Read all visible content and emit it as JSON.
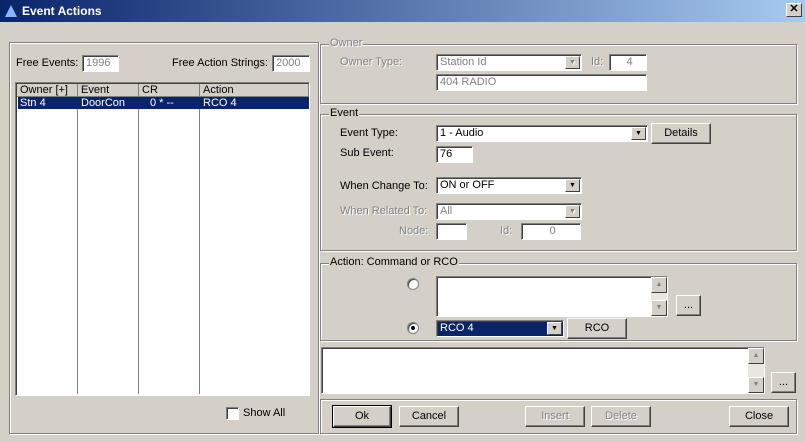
{
  "window": {
    "title": "Event Actions",
    "close": "✕"
  },
  "left": {
    "free_events_label": "Free Events:",
    "free_events": "1996",
    "free_strings_label": "Free Action Strings:",
    "free_strings": "2000",
    "columns": [
      "Owner [+]",
      "Event",
      "CR",
      "Action"
    ],
    "rows": [
      {
        "owner": "Stn 4",
        "event": "DoorCon",
        "cr": "0 * --",
        "action": "RCO 4"
      }
    ],
    "show_all": "Show All"
  },
  "owner": {
    "legend": "Owner",
    "type_label": "Owner Type:",
    "type_value": "Station Id",
    "id_label": "Id:",
    "id_value": "4",
    "name": "404 RADIO"
  },
  "event": {
    "legend": "Event",
    "type_label": "Event Type:",
    "type_value": "1 - Audio",
    "details": "Details",
    "sub_label": "Sub Event:",
    "sub_value": "76",
    "change_label": "When Change To:",
    "change_value": "ON or OFF",
    "related_label": "When Related To:",
    "related_value": "All",
    "node_label": "Node:",
    "node_value": "",
    "id_label": "Id:",
    "id_value": "0"
  },
  "action": {
    "legend": "Action: Command or RCO",
    "command_value": "",
    "more": "...",
    "rco_value": "RCO 4",
    "rco_button": "RCO"
  },
  "notes": {
    "value": "",
    "more": "..."
  },
  "buttons": {
    "ok": "Ok",
    "cancel": "Cancel",
    "insert": "Insert",
    "delete": "Delete",
    "close": "Close"
  }
}
